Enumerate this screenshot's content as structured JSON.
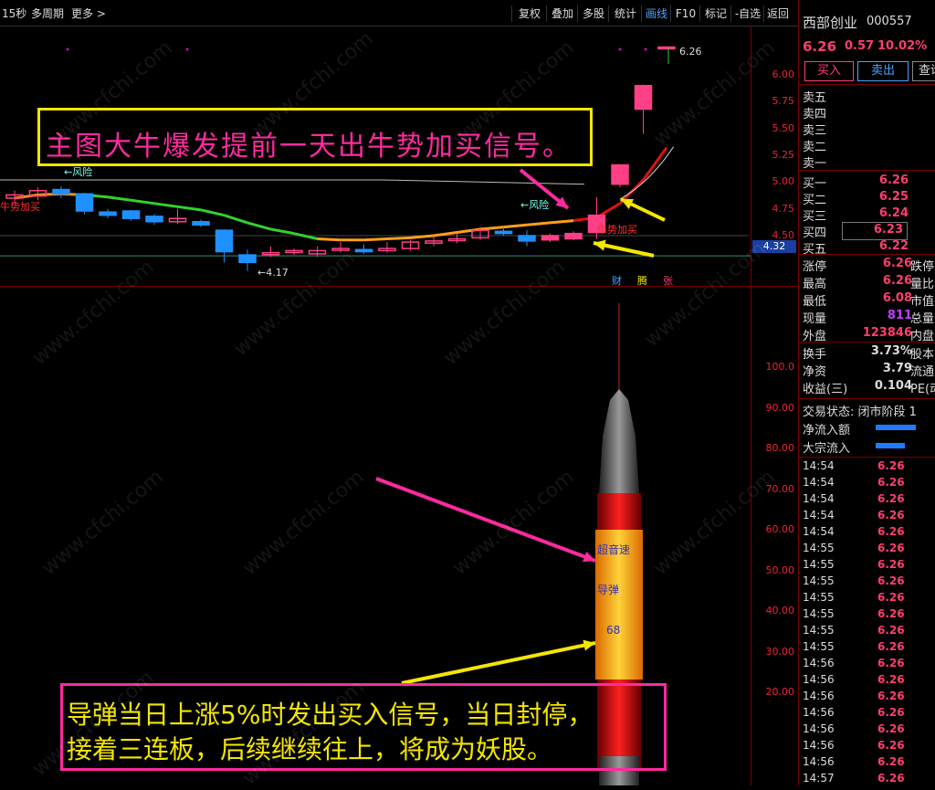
{
  "toolbar": {
    "period": "15秒",
    "multi_period": "多周期",
    "more": "更多 >",
    "buttons": [
      "复权",
      "叠加",
      "多股",
      "统计",
      "画线",
      "F10",
      "标记",
      "-自选",
      "返回"
    ],
    "active_index": 4
  },
  "main_chart": {
    "price_ticks": [
      "6.00",
      "5.75",
      "5.50",
      "5.25",
      "5.00",
      "4.75",
      "4.50"
    ],
    "current_price_tag": "4.32",
    "high_label": "6.26",
    "low_label": "←4.17",
    "risk_label_1": "←风险",
    "risk_label_2": "←风险",
    "buy_label_left": "牛势加买",
    "buy_label_right": "牛势加买",
    "flags": [
      "财",
      "腾",
      "张"
    ],
    "flag_colors": [
      "#4aa3ff",
      "#f5e600",
      "#ff3f6e"
    ],
    "candles": [
      {
        "o": 4.85,
        "c": 4.88,
        "h": 4.92,
        "l": 4.8,
        "up": true
      },
      {
        "o": 4.87,
        "c": 4.92,
        "h": 4.95,
        "l": 4.83,
        "up": true
      },
      {
        "o": 4.93,
        "c": 4.89,
        "h": 4.96,
        "l": 4.85,
        "up": false
      },
      {
        "o": 4.89,
        "c": 4.73,
        "h": 4.9,
        "l": 4.7,
        "up": false
      },
      {
        "o": 4.72,
        "c": 4.69,
        "h": 4.75,
        "l": 4.66,
        "up": false
      },
      {
        "o": 4.73,
        "c": 4.66,
        "h": 4.74,
        "l": 4.64,
        "up": false
      },
      {
        "o": 4.68,
        "c": 4.63,
        "h": 4.7,
        "l": 4.6,
        "up": false
      },
      {
        "o": 4.63,
        "c": 4.66,
        "h": 4.75,
        "l": 4.61,
        "up": true
      },
      {
        "o": 4.63,
        "c": 4.6,
        "h": 4.65,
        "l": 4.58,
        "up": false
      },
      {
        "o": 4.55,
        "c": 4.35,
        "h": 4.56,
        "l": 4.25,
        "up": false
      },
      {
        "o": 4.32,
        "c": 4.25,
        "h": 4.37,
        "l": 4.17,
        "up": false
      },
      {
        "o": 4.33,
        "c": 4.34,
        "h": 4.4,
        "l": 4.3,
        "up": true
      },
      {
        "o": 4.35,
        "c": 4.36,
        "h": 4.38,
        "l": 4.32,
        "up": true
      },
      {
        "o": 4.33,
        "c": 4.36,
        "h": 4.4,
        "l": 4.3,
        "up": true
      },
      {
        "o": 4.37,
        "c": 4.38,
        "h": 4.44,
        "l": 4.34,
        "up": true
      },
      {
        "o": 4.37,
        "c": 4.35,
        "h": 4.42,
        "l": 4.33,
        "up": false
      },
      {
        "o": 4.36,
        "c": 4.38,
        "h": 4.44,
        "l": 4.34,
        "up": true
      },
      {
        "o": 4.38,
        "c": 4.44,
        "h": 4.46,
        "l": 4.36,
        "up": true
      },
      {
        "o": 4.43,
        "c": 4.45,
        "h": 4.49,
        "l": 4.4,
        "up": true
      },
      {
        "o": 4.46,
        "c": 4.47,
        "h": 4.52,
        "l": 4.43,
        "up": true
      },
      {
        "o": 4.48,
        "c": 4.55,
        "h": 4.58,
        "l": 4.46,
        "up": true
      },
      {
        "o": 4.54,
        "c": 4.52,
        "h": 4.58,
        "l": 4.5,
        "up": false
      },
      {
        "o": 4.5,
        "c": 4.45,
        "h": 4.55,
        "l": 4.4,
        "up": false
      },
      {
        "o": 4.46,
        "c": 4.5,
        "h": 4.52,
        "l": 4.44,
        "up": true
      },
      {
        "o": 4.47,
        "c": 4.52,
        "h": 4.54,
        "l": 4.46,
        "up": true
      },
      {
        "o": 4.53,
        "c": 4.69,
        "h": 4.86,
        "l": 4.47,
        "up": true
      },
      {
        "o": 4.98,
        "c": 5.16,
        "h": 5.16,
        "l": 4.95,
        "up": true
      },
      {
        "o": 5.68,
        "c": 5.9,
        "h": 5.91,
        "l": 5.45,
        "up": true
      },
      {
        "o": 6.26,
        "c": 6.26,
        "h": 6.26,
        "l": 6.26,
        "up": true
      }
    ]
  },
  "indicator": {
    "ticks": [
      "100.0",
      "90.00",
      "80.00",
      "70.00",
      "60.00",
      "50.00",
      "40.00",
      "30.00",
      "20.00"
    ],
    "rocket_text_1": "超音速",
    "rocket_text_2": "导弹",
    "rocket_value": "68"
  },
  "annotations": {
    "box1": "主图大牛爆发提前一天出牛势加买信号。",
    "box2_line1": "导弹当日上涨5%时发出买入信号，当日封停，",
    "box2_line2": "接着三连板，后续继续往上，将成为妖股。"
  },
  "watermark": "www.cfchi.com",
  "panel": {
    "stock_name": "西部创业",
    "stock_code": "000557",
    "price": "6.26",
    "change": "0.57",
    "change_pct": "10.02%",
    "buy_button": "买入",
    "sell_button": "卖出",
    "query_button": "查询",
    "asks": [
      "卖五",
      "卖四",
      "卖三",
      "卖二",
      "卖一"
    ],
    "bids": [
      {
        "label": "买一",
        "price": "6.26"
      },
      {
        "label": "买二",
        "price": "6.25"
      },
      {
        "label": "买三",
        "price": "6.24"
      },
      {
        "label": "买四",
        "price": "6.23"
      },
      {
        "label": "买五",
        "price": "6.22"
      }
    ],
    "stats": [
      {
        "label": "涨停",
        "value": "6.26",
        "right": "跌停"
      },
      {
        "label": "最高",
        "value": "6.26",
        "right": "量比"
      },
      {
        "label": "最低",
        "value": "6.08",
        "right": "市值"
      },
      {
        "label": "现量",
        "value": "811",
        "right": "总量"
      },
      {
        "label": "外盘",
        "value": "123846",
        "right": "内盘"
      }
    ],
    "stats2": [
      {
        "label": "换手",
        "value": "3.73%",
        "right": "股本"
      },
      {
        "label": "净资",
        "value": "3.79",
        "right": "流通"
      },
      {
        "label": "收益(三)",
        "value": "0.104",
        "right": "PE(动"
      }
    ],
    "trade_status": "交易状态: 闭市阶段 1",
    "net_inflow": "净流入额",
    "block_inflow": "大宗流入",
    "ticks": [
      {
        "time": "14:54",
        "price": "6.26"
      },
      {
        "time": "14:54",
        "price": "6.26"
      },
      {
        "time": "14:54",
        "price": "6.26"
      },
      {
        "time": "14:54",
        "price": "6.26"
      },
      {
        "time": "14:54",
        "price": "6.26"
      },
      {
        "time": "14:55",
        "price": "6.26"
      },
      {
        "time": "14:55",
        "price": "6.26"
      },
      {
        "time": "14:55",
        "price": "6.26"
      },
      {
        "time": "14:55",
        "price": "6.26"
      },
      {
        "time": "14:55",
        "price": "6.26"
      },
      {
        "time": "14:55",
        "price": "6.26"
      },
      {
        "time": "14:55",
        "price": "6.26"
      },
      {
        "time": "14:56",
        "price": "6.26"
      },
      {
        "time": "14:56",
        "price": "6.26"
      },
      {
        "time": "14:56",
        "price": "6.26"
      },
      {
        "time": "14:56",
        "price": "6.26"
      },
      {
        "time": "14:56",
        "price": "6.26"
      },
      {
        "time": "14:56",
        "price": "6.26"
      },
      {
        "time": "14:56",
        "price": "6.26"
      },
      {
        "time": "14:57",
        "price": "6.26"
      }
    ]
  }
}
